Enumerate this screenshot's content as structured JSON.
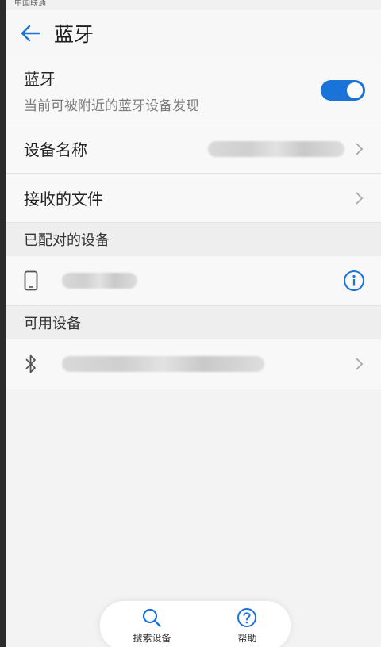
{
  "status_bar": {
    "carrier": "中国联通"
  },
  "header": {
    "title": "蓝牙",
    "back_icon": "back-arrow-icon"
  },
  "bluetooth": {
    "label": "蓝牙",
    "subtitle": "当前可被附近的蓝牙设备发现",
    "enabled": true
  },
  "rows": {
    "device_name_label": "设备名称",
    "received_files_label": "接收的文件"
  },
  "paired": {
    "section_title": "已配对的设备"
  },
  "available": {
    "section_title": "可用设备"
  },
  "bottom_bar": {
    "search_label": "搜索设备",
    "help_label": "帮助"
  },
  "colors": {
    "accent": "#1a73d8"
  }
}
